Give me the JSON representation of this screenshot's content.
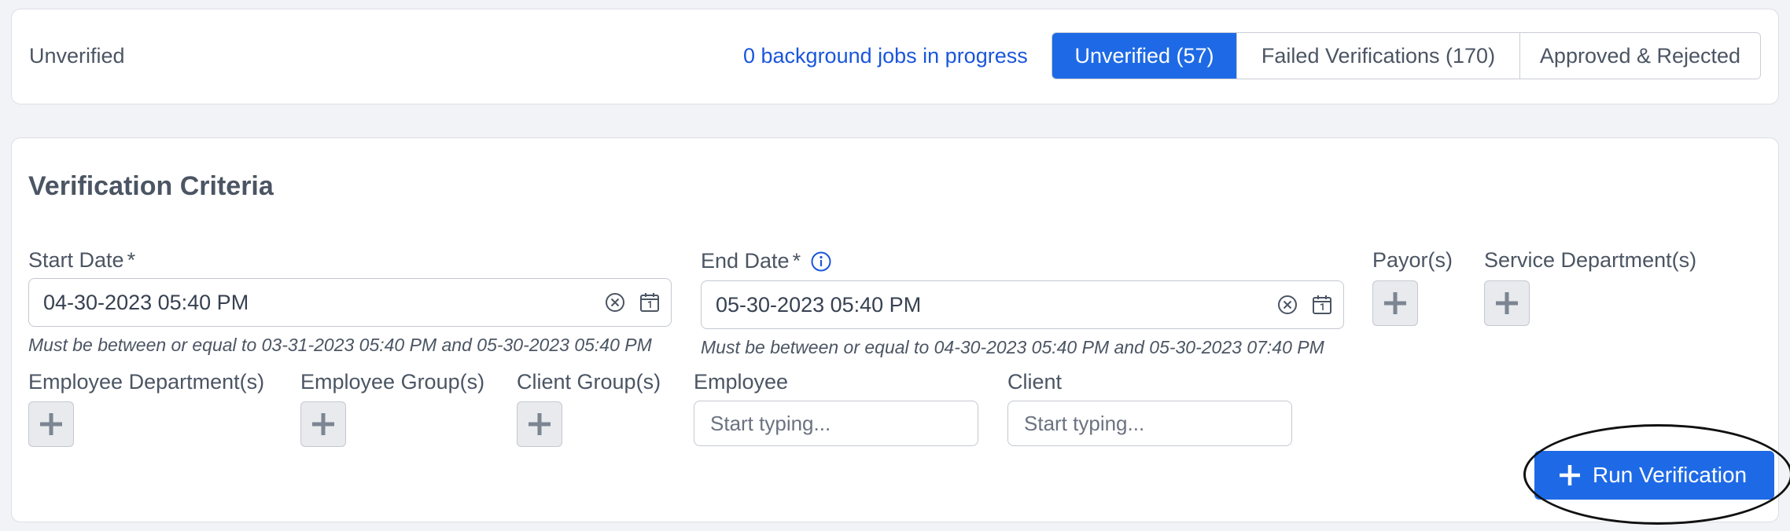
{
  "header": {
    "page_label": "Unverified",
    "jobs_link": "0 background jobs in progress",
    "tabs": [
      {
        "label": "Unverified (57)",
        "active": true
      },
      {
        "label": "Failed Verifications (170)",
        "active": false
      },
      {
        "label": "Approved & Rejected",
        "active": false
      }
    ]
  },
  "criteria": {
    "title": "Verification Criteria",
    "start_date": {
      "label": "Start Date",
      "required_mark": "*",
      "value": "04-30-2023 05:40 PM",
      "hint": "Must be between or equal to 03-31-2023 05:40 PM and 05-30-2023 05:40 PM"
    },
    "end_date": {
      "label": "End Date",
      "required_mark": "*",
      "value": "05-30-2023 05:40 PM",
      "hint": "Must be between or equal to 04-30-2023 05:40 PM and 05-30-2023 07:40 PM"
    },
    "payors_label": "Payor(s)",
    "service_departments_label": "Service Department(s)",
    "employee_departments_label": "Employee Department(s)",
    "employee_groups_label": "Employee Group(s)",
    "client_groups_label": "Client Group(s)",
    "employee": {
      "label": "Employee",
      "placeholder": "Start typing..."
    },
    "client": {
      "label": "Client",
      "placeholder": "Start typing..."
    },
    "run_button": "Run Verification"
  },
  "colors": {
    "accent": "#1e6ae6",
    "link": "#1a56db",
    "background": "#f2f3f6",
    "text": "#4b5563"
  },
  "icons": [
    "clear-icon",
    "calendar-icon",
    "info-icon",
    "plus-icon"
  ]
}
